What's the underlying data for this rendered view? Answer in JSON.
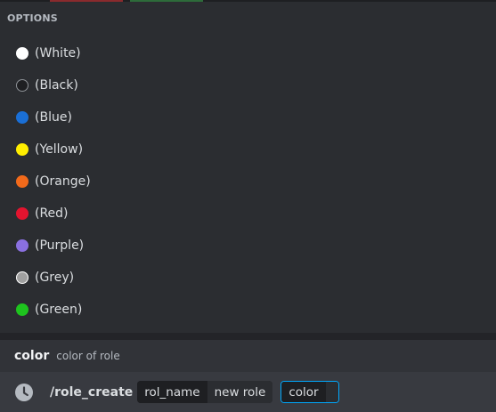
{
  "options": {
    "header": "OPTIONS",
    "items": [
      {
        "label": "(White)",
        "color": "#ffffff",
        "border": "#ffffff"
      },
      {
        "label": "(Black)",
        "color": "#1e1f22",
        "border": "#8e9297"
      },
      {
        "label": "(Blue)",
        "color": "#1a6fd6",
        "border": "#1a6fd6"
      },
      {
        "label": "(Yellow)",
        "color": "#ffee00",
        "border": "#ffee00"
      },
      {
        "label": "(Orange)",
        "color": "#f26a1b",
        "border": "#f26a1b"
      },
      {
        "label": "(Red)",
        "color": "#e3142f",
        "border": "#e3142f"
      },
      {
        "label": "(Purple)",
        "color": "#8a70e0",
        "border": "#8a70e0"
      },
      {
        "label": "(Grey)",
        "color": "#a0a0a0",
        "border": "#ffffff"
      },
      {
        "label": "(Green)",
        "color": "#1ec41e",
        "border": "#1ec41e"
      }
    ]
  },
  "param_hint": {
    "name": "color",
    "description": "color of role"
  },
  "command_bar": {
    "icon": "clock-icon",
    "command": "/role_create",
    "chips": [
      {
        "key": "rol_name",
        "value": "new role"
      },
      {
        "key": "color",
        "value": ""
      }
    ]
  },
  "colors": {
    "background": "#2b2d31",
    "command_bar": "#383a40",
    "active_border": "#00a8fc"
  }
}
